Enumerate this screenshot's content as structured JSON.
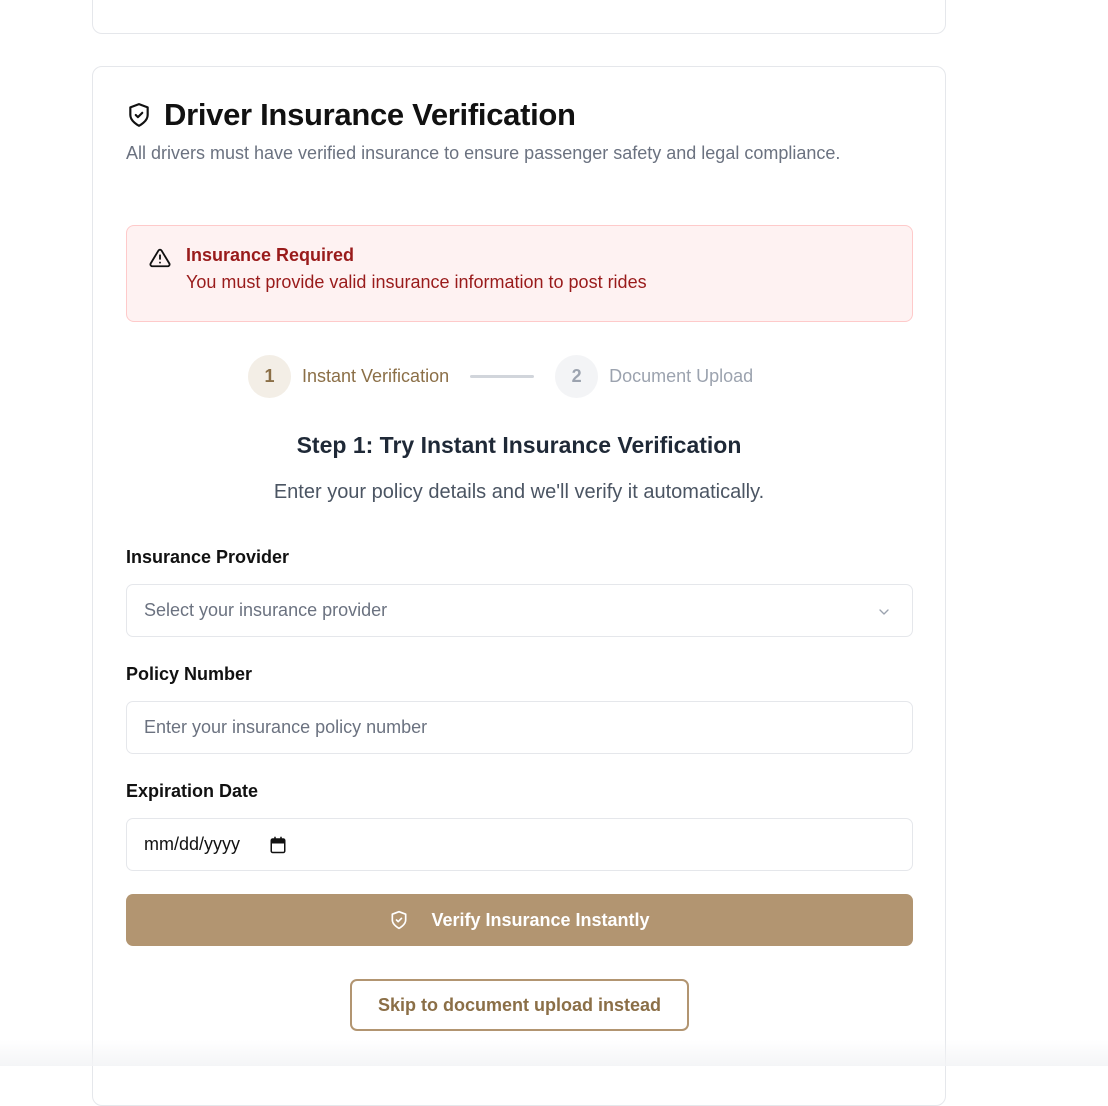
{
  "card": {
    "title": "Driver Insurance Verification",
    "subtitle": "All drivers must have verified insurance to ensure passenger safety and legal compliance.",
    "icon": "shield-check-icon"
  },
  "alert": {
    "title": "Insurance Required",
    "message": "You must provide valid insurance information to post rides",
    "icon": "warning-triangle-icon"
  },
  "stepper": {
    "steps": [
      {
        "number": "1",
        "label": "Instant Verification",
        "state": "active"
      },
      {
        "number": "2",
        "label": "Document Upload",
        "state": "inactive"
      }
    ]
  },
  "step1": {
    "heading": "Step 1: Try Instant Insurance Verification",
    "description": "Enter your policy details and we'll verify it automatically."
  },
  "form": {
    "provider_label": "Insurance Provider",
    "provider_placeholder": "Select your insurance provider",
    "policy_label": "Policy Number",
    "policy_placeholder": "Enter your insurance policy number",
    "expiration_label": "Expiration Date",
    "expiration_placeholder": "mm/dd/yyyy"
  },
  "actions": {
    "verify_label": "Verify Insurance Instantly",
    "skip_label": "Skip to document upload instead"
  },
  "colors": {
    "accent": "#b29571",
    "accent_text": "#8b6f47",
    "alert_bg": "#fef2f2",
    "alert_text": "#991b1b"
  }
}
